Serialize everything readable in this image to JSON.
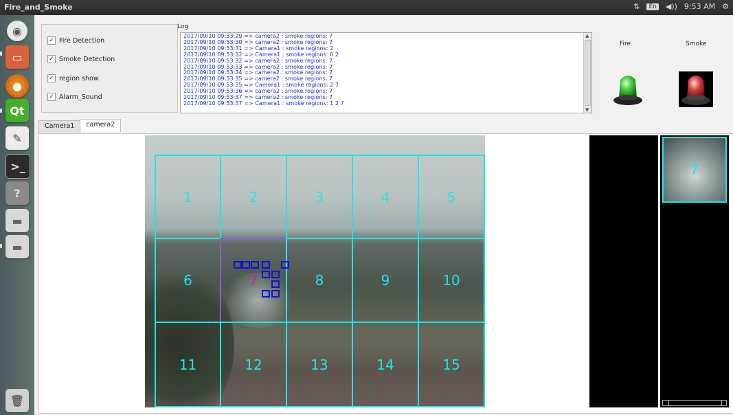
{
  "window": {
    "title": "Fire_and_Smoke"
  },
  "tray": {
    "keyboard": "En",
    "volume_icon": "volume-icon",
    "time": "9:53 AM"
  },
  "launcher": {
    "items": [
      "dash-icon",
      "files-icon",
      "firefox-icon",
      "qt-creator-icon",
      "text-editor-icon",
      "terminal-icon",
      "help-icon",
      "drive-icon",
      "drive-icon",
      "trash-icon"
    ],
    "qt_label": "Qt"
  },
  "options": {
    "fire_detection": "Fire Detection",
    "smoke_detection": "Smoke Detection",
    "region_show": "region show",
    "alarm_sound": "Alarm_Sound"
  },
  "log": {
    "label": "Log",
    "lines": [
      "2017/09/10 09:53:29 => camera2 :  smoke regions: 7",
      "2017/09/10 09:53:30 => camera2 :  smoke regions: 7",
      "2017/09/10 09:53:31 => Camera1 :  smoke regions: 2",
      "2017/09/10 09:53:32 => Camera1 :  smoke regions: 6 2",
      "2017/09/10 09:53:32 => camera2 :  smoke regions: 7",
      "2017/09/10 09:53:33 => camera2 :  smoke regions: 7",
      "2017/09/10 09:53:34 => camera2 :  smoke regions: 7",
      "2017/09/10 09:53:35 => camera2 :  smoke regions: 7",
      "2017/09/10 09:53:35 => Camera1 :  smoke regions: 2 7",
      "2017/09/10 09:53:36 => camera2 :  smoke regions: 7",
      "2017/09/10 09:53:37 => camera2 :  smoke regions: 7",
      "2017/09/10 09:53:37 => Camera1 :  smoke regions: 1 2 7"
    ]
  },
  "indicators": {
    "fire_label": "Fire",
    "smoke_label": "Smoke",
    "fire_color": "#3fc83a",
    "smoke_color": "#d84040"
  },
  "tabs": {
    "camera1": "Camera1",
    "camera2": "camera2"
  },
  "grid": {
    "labels": [
      "1",
      "2",
      "3",
      "4",
      "5",
      "6",
      "7",
      "8",
      "9",
      "10",
      "11",
      "12",
      "13",
      "14",
      "15"
    ],
    "line_color": "#1ee6e6",
    "smoke_region_color": "#c020c0"
  },
  "thumbnail": {
    "label": "7"
  }
}
